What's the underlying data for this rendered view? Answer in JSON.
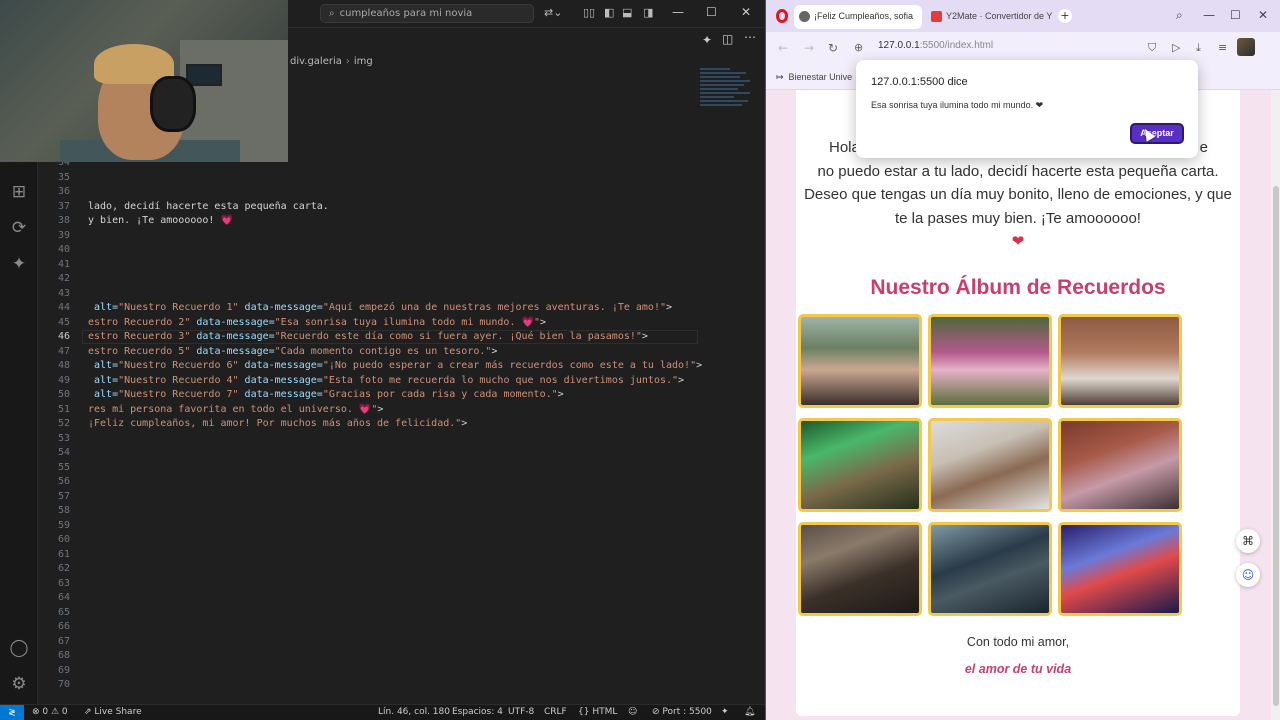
{
  "vscode": {
    "search_text": "cumpleaños para mi novia",
    "breadcrumb": [
      "div.galeria",
      "img"
    ],
    "lines": [
      {
        "n": "34",
        "segs": []
      },
      {
        "n": "35",
        "segs": []
      },
      {
        "n": "36",
        "segs": []
      },
      {
        "n": "37",
        "segs": [
          [
            "t",
            "lado, decidí hacerte esta pequeña carta."
          ]
        ]
      },
      {
        "n": "38",
        "segs": [
          [
            "t",
            "y bien. ¡Te amoooooo! 💗"
          ]
        ]
      },
      {
        "n": "39",
        "segs": []
      },
      {
        "n": "40",
        "segs": []
      },
      {
        "n": "41",
        "segs": []
      },
      {
        "n": "42",
        "segs": []
      },
      {
        "n": "43",
        "segs": []
      },
      {
        "n": "44",
        "segs": [
          [
            "a",
            " alt="
          ],
          [
            "s",
            "\"Nuestro Recuerdo 1\""
          ],
          [
            "a",
            " data-message="
          ],
          [
            "s",
            "\"Aquí empezó una de nuestras mejores aventuras. ¡Te amo!\""
          ],
          [
            "t",
            ">"
          ]
        ]
      },
      {
        "n": "45",
        "segs": [
          [
            "s",
            "estro Recuerdo 2\""
          ],
          [
            "a",
            " data-message="
          ],
          [
            "s",
            "\"Esa sonrisa tuya ilumina todo mi mundo. 💗\""
          ],
          [
            "t",
            ">"
          ]
        ]
      },
      {
        "n": "46",
        "segs": [
          [
            "s",
            "estro Recuerdo 3\""
          ],
          [
            "a",
            " data-message="
          ],
          [
            "s",
            "\"Recuerdo este día como si fuera ayer. ¡Qué bien la pasamos!\""
          ],
          [
            "t",
            ">"
          ]
        ]
      },
      {
        "n": "47",
        "segs": [
          [
            "s",
            "estro Recuerdo 5\""
          ],
          [
            "a",
            " data-message="
          ],
          [
            "s",
            "\"Cada momento contigo es un tesoro.\""
          ],
          [
            "t",
            ">"
          ]
        ]
      },
      {
        "n": "48",
        "segs": [
          [
            "a",
            " alt="
          ],
          [
            "s",
            "\"Nuestro Recuerdo 6\""
          ],
          [
            "a",
            " data-message="
          ],
          [
            "s",
            "\"¡No puedo esperar a crear más recuerdos como este a tu lado!\""
          ],
          [
            "t",
            ">"
          ]
        ]
      },
      {
        "n": "49",
        "segs": [
          [
            "a",
            " alt="
          ],
          [
            "s",
            "\"Nuestro Recuerdo 4\""
          ],
          [
            "a",
            " data-message="
          ],
          [
            "s",
            "\"Esta foto me recuerda lo mucho que nos divertimos juntos.\""
          ],
          [
            "t",
            ">"
          ]
        ]
      },
      {
        "n": "50",
        "segs": [
          [
            "a",
            " alt="
          ],
          [
            "s",
            "\"Nuestro Recuerdo 7\""
          ],
          [
            "a",
            " data-message="
          ],
          [
            "s",
            "\"Gracias por cada risa y cada momento.\""
          ],
          [
            "t",
            ">"
          ]
        ]
      },
      {
        "n": "51",
        "segs": [
          [
            "s",
            "res mi persona favorita en todo el universo. 💗\""
          ],
          [
            "t",
            ">"
          ]
        ]
      },
      {
        "n": "52",
        "segs": [
          [
            "s",
            "¡Feliz cumpleaños, mi amor! Por muchos más años de felicidad.\""
          ],
          [
            "t",
            ">"
          ]
        ]
      },
      {
        "n": "53",
        "segs": []
      },
      {
        "n": "54",
        "segs": []
      },
      {
        "n": "55",
        "segs": []
      },
      {
        "n": "56",
        "segs": []
      },
      {
        "n": "57",
        "segs": []
      },
      {
        "n": "58",
        "segs": []
      },
      {
        "n": "59",
        "segs": []
      },
      {
        "n": "60",
        "segs": []
      },
      {
        "n": "61",
        "segs": []
      },
      {
        "n": "62",
        "segs": []
      },
      {
        "n": "63",
        "segs": []
      },
      {
        "n": "64",
        "segs": []
      },
      {
        "n": "65",
        "segs": []
      },
      {
        "n": "66",
        "segs": []
      },
      {
        "n": "67",
        "segs": []
      },
      {
        "n": "68",
        "segs": []
      },
      {
        "n": "69",
        "segs": []
      },
      {
        "n": "70",
        "segs": []
      }
    ],
    "current_line": "46",
    "status": {
      "problems": "⊗ 0 ⚠ 0",
      "live_share": "Live Share",
      "position": "Lín. 46, col. 180",
      "spaces": "Espacios: 4",
      "encoding": "UTF-8",
      "eol": "CRLF",
      "language": "HTML",
      "port": "Port : 5500"
    }
  },
  "browser": {
    "tab_active": "¡Feliz Cumpleaños, sofia",
    "tab_other": "Y2Mate · Convertidor de Y",
    "url_host": "127.0.0.1",
    "url_rest": ":5500/index.html",
    "bookmark": "Bienestar Unive",
    "letter_line1": "Hola",
    "letter_line1_end": "e",
    "letter_body": "no puedo estar a tu lado, decidí hacerte esta pequeña carta. Deseo que tengas un día muy bonito, lleno de emociones, y que te la pases muy bien. ¡Te amoooooo!",
    "letter_heart": "❤",
    "album_title": "Nuestro Álbum de Recuerdos",
    "closing": "Con todo mi amor,",
    "signature": "el amor de tu vida",
    "dialog": {
      "title": "127.0.0.1:5500 dice",
      "message": "Esa sonrisa tuya ilumina todo mi mundo. ❤",
      "button": "Aceptar"
    },
    "accent": "#c73f6f",
    "photo_border": "#f2c94c"
  }
}
